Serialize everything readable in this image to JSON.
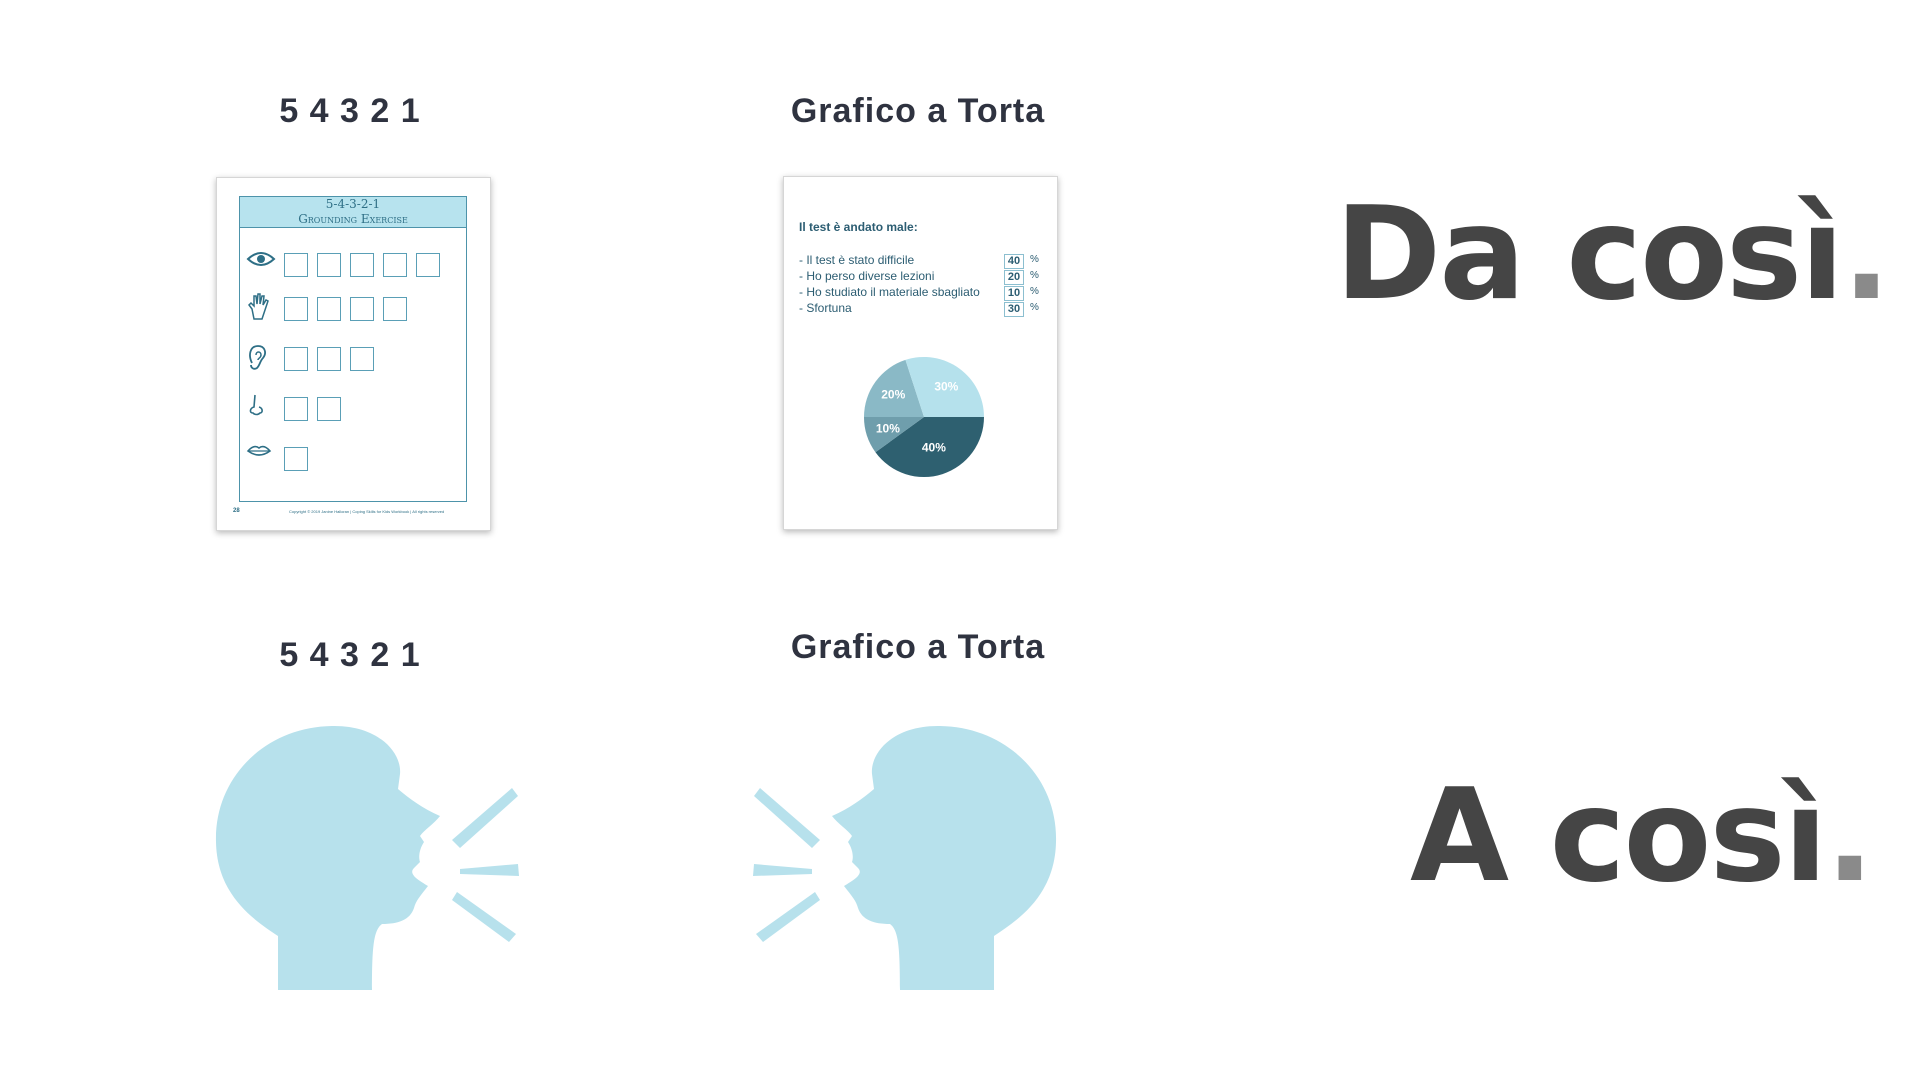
{
  "top": {
    "left_heading": "5 4 3 2 1",
    "middle_heading": "Grafico a Torta",
    "right_text": "Da così",
    "right_dot": "."
  },
  "bottom": {
    "left_heading": "5 4 3 2 1",
    "middle_heading": "Grafico a Torta",
    "right_text": "A così",
    "right_dot": "."
  },
  "worksheet": {
    "title_line1": "5-4-3-2-1",
    "title_line2": "Grounding Exercise",
    "page_number": "28",
    "footer": "Copyright © 2019 Janine Halloran | Coping Skills for Kids Workbook | All rights reserved",
    "rows": [
      {
        "icon": "eye-icon",
        "boxes": 5
      },
      {
        "icon": "hand-icon",
        "boxes": 4
      },
      {
        "icon": "ear-icon",
        "boxes": 3
      },
      {
        "icon": "nose-icon",
        "boxes": 2
      },
      {
        "icon": "lips-icon",
        "boxes": 1
      }
    ]
  },
  "pie_doc": {
    "title": "Il test è andato male:",
    "items": [
      {
        "label": "- Il test è stato difficile",
        "value": "40",
        "unit": "%"
      },
      {
        "label": "- Ho perso diverse lezioni",
        "value": "20",
        "unit": "%"
      },
      {
        "label": "- Ho studiato il materiale sbagliato",
        "value": "10",
        "unit": "%"
      },
      {
        "label": "- Sfortuna",
        "value": "30",
        "unit": "%"
      }
    ]
  },
  "chart_data": {
    "type": "pie",
    "categories": [
      "Il test è stato difficile",
      "Ho perso diverse lezioni",
      "Ho studiato il materiale sbagliato",
      "Sfortuna"
    ],
    "values": [
      40,
      20,
      10,
      30
    ],
    "labels": [
      "40%",
      "20%",
      "10%",
      "30%"
    ],
    "colors": [
      "#2e6070",
      "#8ab9c6",
      "#6f9eac",
      "#b5e1ec"
    ]
  },
  "icons": {
    "left_speaker": "speaking-head-icon",
    "right_speaker": "speaking-head-icon"
  },
  "colors": {
    "speaker": "#b7e1ec",
    "heading": "#2f3340",
    "big_text": "#454545",
    "dot": "#8a8a8a"
  }
}
